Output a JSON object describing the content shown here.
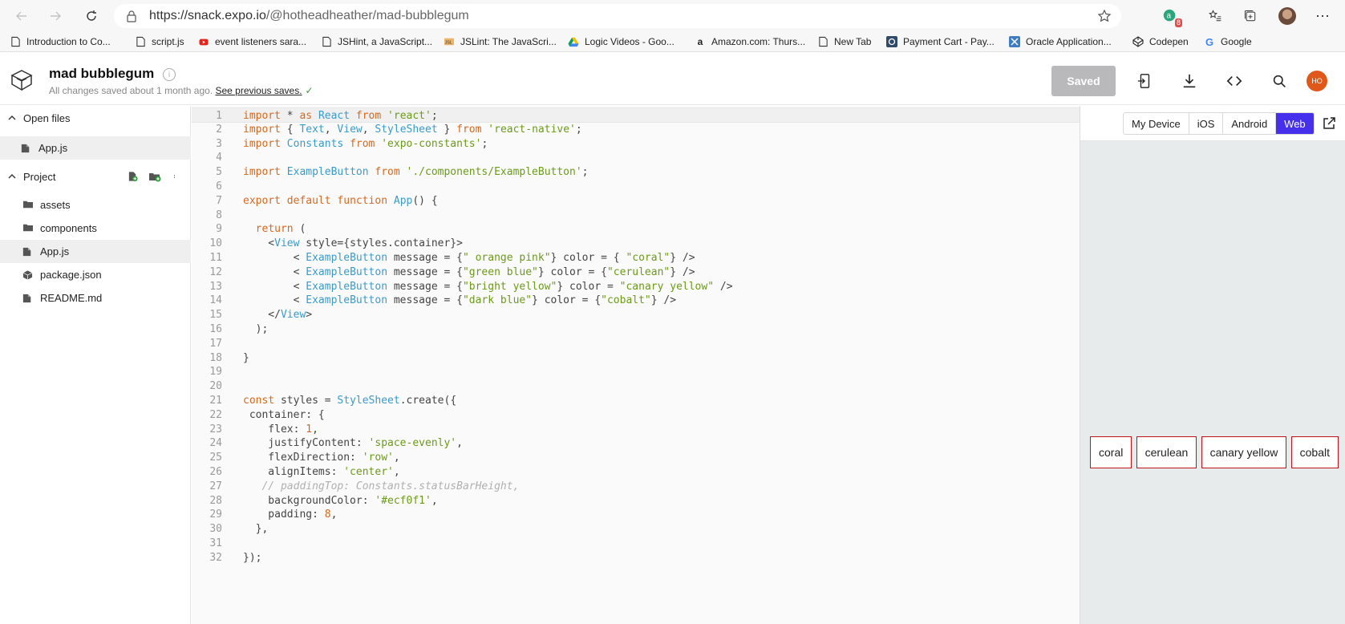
{
  "browser": {
    "url_host": "https://snack.expo.io",
    "url_path": "/@hotheadheather/mad-bubblegum",
    "extension_badge": "8",
    "bookmarks": [
      {
        "label": "Introduction to Co...",
        "icon": "page-icon"
      },
      {
        "label": "script.js",
        "icon": "page-icon"
      },
      {
        "label": "event listeners sara...",
        "icon": "youtube-icon"
      },
      {
        "label": "JSHint, a JavaScript...",
        "icon": "page-icon"
      },
      {
        "label": "JSLint: The JavaScri...",
        "icon": "jslint-icon"
      },
      {
        "label": "Logic Videos - Goo...",
        "icon": "google-drive-icon"
      },
      {
        "label": "Amazon.com: Thurs...",
        "icon": "amazon-icon"
      },
      {
        "label": "New Tab",
        "icon": "page-icon"
      },
      {
        "label": "Payment Cart - Pay...",
        "icon": "payment-icon"
      },
      {
        "label": "Oracle Application...",
        "icon": "oracle-icon"
      },
      {
        "label": "Codepen",
        "icon": "codepen-icon"
      },
      {
        "label": "Google",
        "icon": "google-icon"
      }
    ]
  },
  "header": {
    "title": "mad bubblegum",
    "status": "All changes saved about 1 month ago.",
    "status_link": "See previous saves.",
    "saved_label": "Saved",
    "avatar_initials": "HO"
  },
  "sidebar": {
    "open_files_label": "Open files",
    "open_files": [
      "App.js"
    ],
    "project_label": "Project",
    "project_items": [
      {
        "label": "assets",
        "icon": "folder-icon"
      },
      {
        "label": "components",
        "icon": "folder-icon"
      },
      {
        "label": "App.js",
        "icon": "js-file-icon"
      },
      {
        "label": "package.json",
        "icon": "package-icon"
      },
      {
        "label": "README.md",
        "icon": "markdown-file-icon"
      }
    ]
  },
  "editor": {
    "lines": [
      "import * as React from 'react';",
      "import { Text, View, StyleSheet } from 'react-native';",
      "import Constants from 'expo-constants';",
      "",
      "import ExampleButton from './components/ExampleButton';",
      "",
      "export default function App() {",
      "",
      "  return (",
      "    <View style={styles.container}>",
      "        < ExampleButton message = {\" orange pink\"} color = { \"coral\"} />",
      "        < ExampleButton message = {\"green blue\"} color = {\"cerulean\"} />",
      "        < ExampleButton message = {\"bright yellow\"} color = \"canary yellow\" />",
      "        < ExampleButton message = {\"dark blue\"} color = {\"cobalt\"} />",
      "    </View>",
      "  );",
      "",
      "}",
      "",
      "",
      "const styles = StyleSheet.create({",
      " container: {",
      "    flex: 1,",
      "    justifyContent: 'space-evenly',",
      "    flexDirection: 'row',",
      "    alignItems: 'center',",
      "   // paddingTop: Constants.statusBarHeight,",
      "    backgroundColor: '#ecf0f1',",
      "    padding: 8,",
      "  },",
      "",
      "});"
    ]
  },
  "preview": {
    "tabs": [
      "My Device",
      "iOS",
      "Android",
      "Web"
    ],
    "active_tab": "Web",
    "buttons": [
      "coral",
      "cerulean",
      "canary yellow",
      "cobalt"
    ]
  },
  "colors": {
    "accent": "#4630eb",
    "button_border": "#c0121c",
    "keyword": "#d4691f",
    "identifier": "#3a9bc9",
    "string": "#6c9a19"
  }
}
